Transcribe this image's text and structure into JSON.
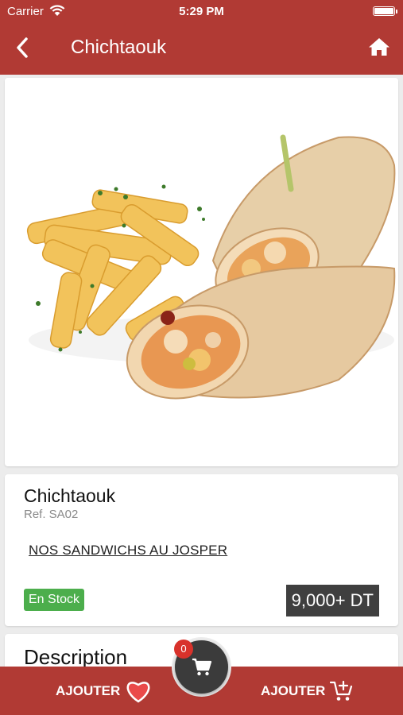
{
  "status_bar": {
    "carrier": "Carrier",
    "time": "5:29 PM"
  },
  "nav": {
    "title": "Chichtaouk",
    "back_icon": "chevron-left-icon",
    "home_icon": "home-icon"
  },
  "product": {
    "image_alt": "wrap-and-fries-photo",
    "name": "Chichtaouk",
    "ref": "Ref. SA02",
    "category": "NOS SANDWICHS AU JOSPER",
    "stock": "En Stock",
    "price": "9,000+ DT"
  },
  "description": {
    "title": "Description"
  },
  "bottom_bar": {
    "favorite_label": "AJOUTER",
    "cart_label": "AJOUTER",
    "cart_count": "0"
  },
  "colors": {
    "primary": "#b13a34",
    "stock_green": "#4cae4c",
    "price_bg": "#3f3f3f",
    "cart_badge": "#d8322b"
  }
}
